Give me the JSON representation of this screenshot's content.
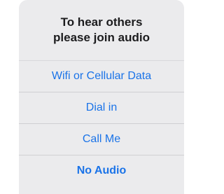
{
  "dialog": {
    "title_line1": "To hear others",
    "title_line2": "please join audio"
  },
  "options": [
    {
      "label": "Wifi or Cellular Data"
    },
    {
      "label": "Dial in"
    },
    {
      "label": "Call Me"
    },
    {
      "label": "No Audio"
    }
  ],
  "colors": {
    "accent": "#1a73e8",
    "sheet_background": "#ebebed",
    "title_text": "#1c1c1e"
  }
}
